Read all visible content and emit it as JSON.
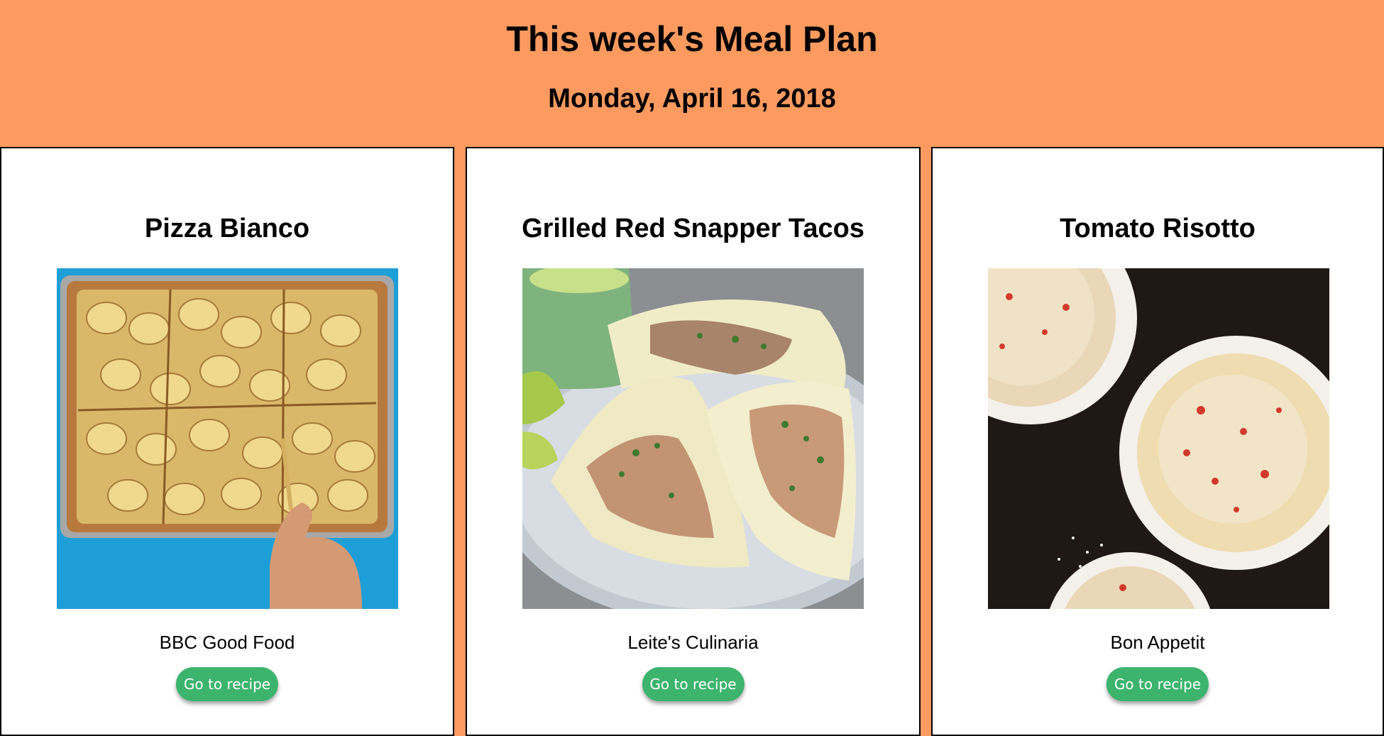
{
  "header": {
    "title": "This week's Meal Plan",
    "date": "Monday, April 16, 2018"
  },
  "meals": [
    {
      "title": "Pizza Bianco",
      "source": "BBC Good Food",
      "button_label": "Go to recipe"
    },
    {
      "title": "Grilled Red Snapper Tacos",
      "source": "Leite's Culinaria",
      "button_label": "Go to recipe"
    },
    {
      "title": "Tomato Risotto",
      "source": "Bon Appetit",
      "button_label": "Go to recipe"
    }
  ],
  "colors": {
    "background": "#fc9a5f",
    "button": "#3cb46e",
    "card": "#ffffff"
  }
}
